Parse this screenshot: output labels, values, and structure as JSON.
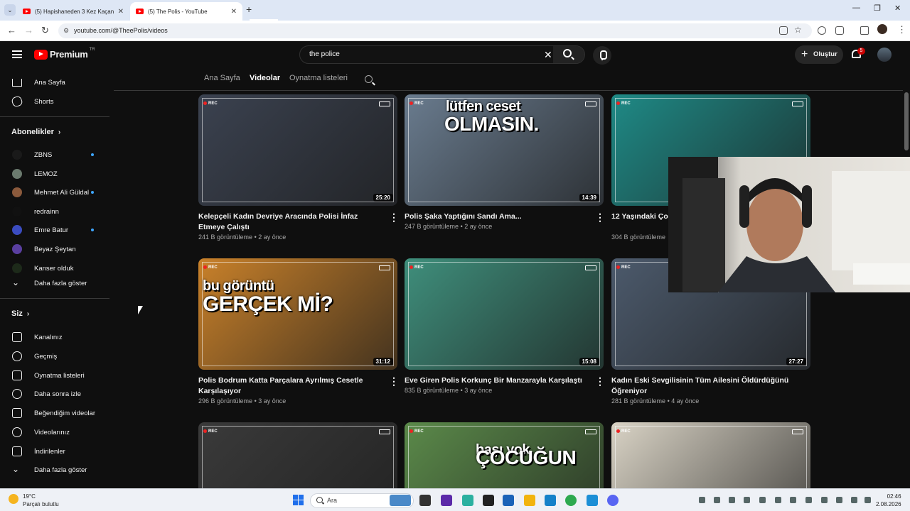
{
  "browser": {
    "tabs": [
      {
        "title": "(5) Hapishaneden 3 Kez Kaçan A",
        "active": false
      },
      {
        "title": "(5) The Polis - YouTube",
        "active": true
      }
    ],
    "url": "youtube.com/@TheePolis/videos"
  },
  "masthead": {
    "logo_text": "Premium",
    "region": "TR",
    "search_query": "the police",
    "create_label": "Oluştur",
    "notification_count": "5"
  },
  "sidebar": {
    "main": [
      {
        "label": "Ana Sayfa",
        "icon": "home-icon"
      },
      {
        "label": "Shorts",
        "icon": "shorts-icon"
      }
    ],
    "subscriptions_heading": "Abonelikler",
    "subscriptions": [
      {
        "label": "ZBNS",
        "new": true,
        "color": "#1a1a1a"
      },
      {
        "label": "LEMOZ",
        "new": false,
        "color": "#6b7a6e"
      },
      {
        "label": "Mehmet Ali Güldal",
        "new": true,
        "color": "#8b5a3c"
      },
      {
        "label": "redrainn",
        "new": false,
        "color": "#111111"
      },
      {
        "label": "Emre Batur",
        "new": true,
        "color": "#3b4cc0"
      },
      {
        "label": "Beyaz Şeytan",
        "new": false,
        "color": "#5a3fa0"
      },
      {
        "label": "Kanser olduk",
        "new": false,
        "color": "#1d2a1a"
      }
    ],
    "subs_more": "Daha fazla göster",
    "you_heading": "Siz",
    "you_items": [
      {
        "label": "Kanalınız",
        "icon": "channel-icon"
      },
      {
        "label": "Geçmiş",
        "icon": "history-icon"
      },
      {
        "label": "Oynatma listeleri",
        "icon": "playlists-icon"
      },
      {
        "label": "Daha sonra izle",
        "icon": "watch-later-icon"
      },
      {
        "label": "Beğendiğim videolar",
        "icon": "liked-icon"
      },
      {
        "label": "Videolarınız",
        "icon": "your-videos-icon"
      },
      {
        "label": "İndirilenler",
        "icon": "downloads-icon"
      },
      {
        "label": "Daha fazla göster",
        "icon": "chevron-down-icon"
      }
    ]
  },
  "channel_tabs": [
    {
      "label": "Ana Sayfa",
      "active": false
    },
    {
      "label": "Videolar",
      "active": true
    },
    {
      "label": "Oynatma listeleri",
      "active": false
    }
  ],
  "videos": [
    {
      "title": "Kelepçeli Kadın Devriye Aracında Polisi İnfaz Etmeye Çalıştı",
      "views": "241 B görüntüleme",
      "age": "2 ay önce",
      "duration": "25:20",
      "overlay": "",
      "bg": "#3b4250"
    },
    {
      "title": "Polis Şaka Yaptığını Sandı Ama...",
      "views": "247 B görüntüleme",
      "age": "2 ay önce",
      "duration": "14:39",
      "overlay_small": "lütfen ceset",
      "overlay": "OLMASIN.",
      "bg": "#6a7c8f"
    },
    {
      "title": "12 Yaşındaki Çoc... Sonuçlandı",
      "views": "304 B görüntüleme",
      "age": "",
      "duration": "",
      "overlay": "",
      "bg": "#1f8a86"
    },
    {
      "title": "Polis Bodrum Katta Parçalara Ayrılmış Cesetle Karşılaşıyor",
      "views": "296 B görüntüleme",
      "age": "3 ay önce",
      "duration": "31:12",
      "overlay_small": "bu görüntü",
      "overlay": "GERÇEK Mİ?",
      "bg": "#c9812a"
    },
    {
      "title": "Eve Giren Polis Korkunç Bir Manzarayla Karşılaştı",
      "views": "835 B görüntüleme",
      "age": "3 ay önce",
      "duration": "15:08",
      "overlay": "",
      "bg": "#3f8f7c"
    },
    {
      "title": "Kadın Eski Sevgilisinin Tüm Ailesini Öldürdüğünü Öğreniyor",
      "views": "281 B görüntüleme",
      "age": "4 ay önce",
      "duration": "27:27",
      "overlay": "",
      "bg": "#4c5a6c"
    },
    {
      "title": "",
      "views": "",
      "age": "",
      "duration": "",
      "overlay": "",
      "bg": "#3a3a3a"
    },
    {
      "title": "",
      "views": "",
      "age": "",
      "duration": "",
      "overlay_small": "başı yok",
      "overlay": "ÇOCUĞUN",
      "bg": "#5b8a4a"
    },
    {
      "title": "",
      "views": "",
      "age": "",
      "duration": "",
      "overlay": "",
      "bg": "#d9d3c5"
    }
  ],
  "taskbar": {
    "temperature": "19°C",
    "weather": "Parçalı bulutlu",
    "search_label": "Ara",
    "time": "02:46",
    "date": "2.08.2026"
  }
}
